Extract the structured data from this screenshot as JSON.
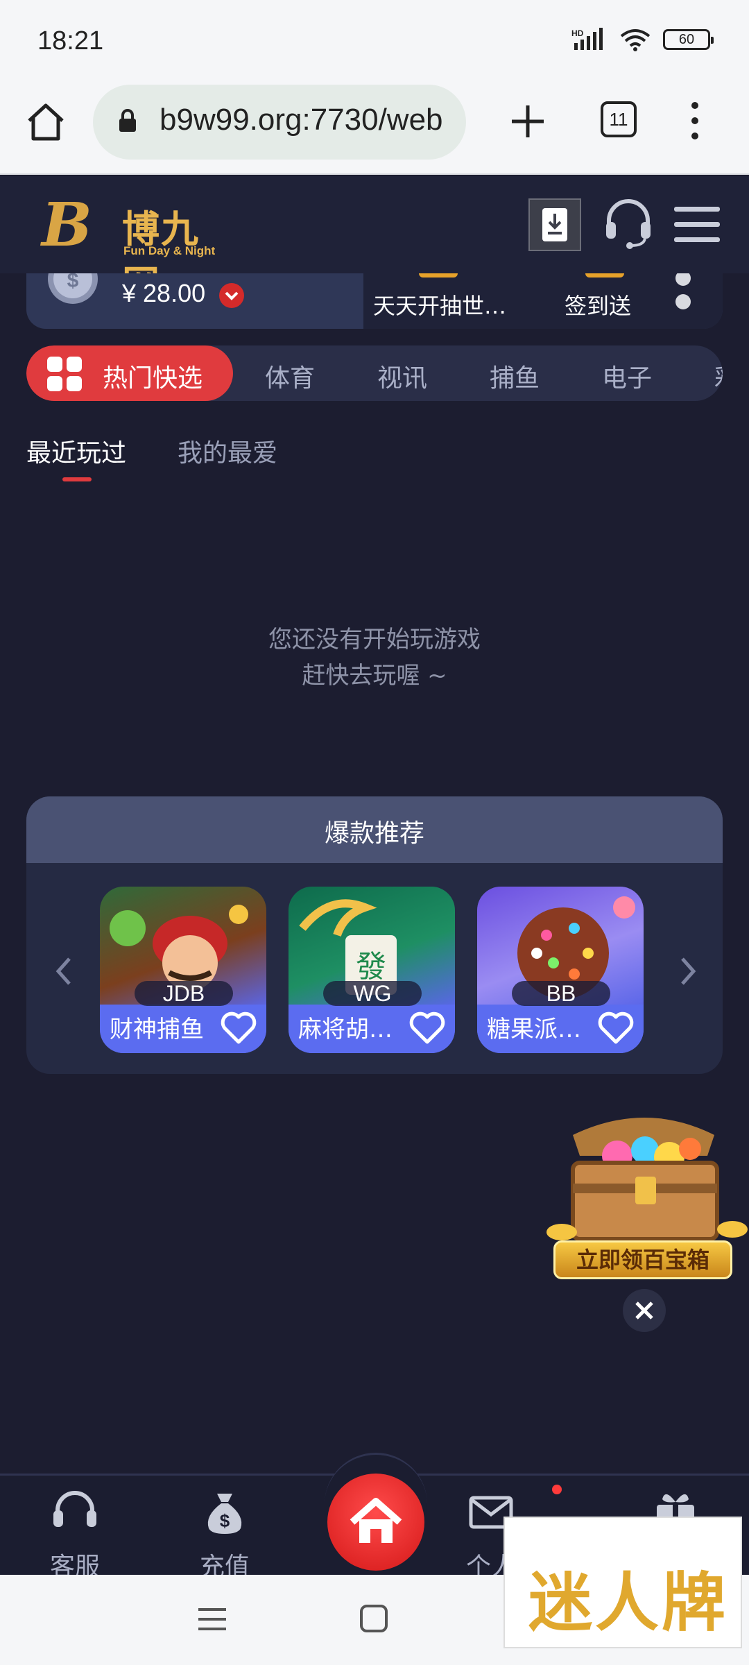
{
  "status_bar": {
    "time": "18:21",
    "battery": "60"
  },
  "browser": {
    "url": "b9w99.org:7730/web",
    "tab_count": "11"
  },
  "site": {
    "logo_letter": "B",
    "logo_name": "博九网",
    "logo_slogan": "Fun Day & Night"
  },
  "account": {
    "balance": "¥ 28.00"
  },
  "notices": [
    "天天开抽世…",
    "签到送"
  ],
  "categories": {
    "active": "热门快选",
    "items": [
      "体育",
      "视讯",
      "捕鱼",
      "电子",
      "彩"
    ]
  },
  "sub_tabs": {
    "recent": "最近玩过",
    "favorites": "我的最爱"
  },
  "empty_state": {
    "line1": "您还没有开始玩游戏",
    "line2": "赶快去玩喔 ~"
  },
  "recommend": {
    "title": "爆款推荐",
    "games": [
      {
        "provider": "JDB",
        "name": "财神捕鱼"
      },
      {
        "provider": "WG",
        "name": "麻将胡…"
      },
      {
        "provider": "BB",
        "name": "糖果派…"
      }
    ]
  },
  "treasure": {
    "label": "立即领百宝箱"
  },
  "bottom_nav": {
    "service": "客服",
    "deposit": "充值",
    "profile": "个人",
    "home_icon": "home-icon",
    "mail_icon": "mail-icon",
    "gift_icon": "gift-icon"
  },
  "watermark": {
    "text": "迷人牌"
  },
  "colors": {
    "accent": "#e03b3e",
    "background": "#1c1d30",
    "gold": "#e8b54f"
  }
}
